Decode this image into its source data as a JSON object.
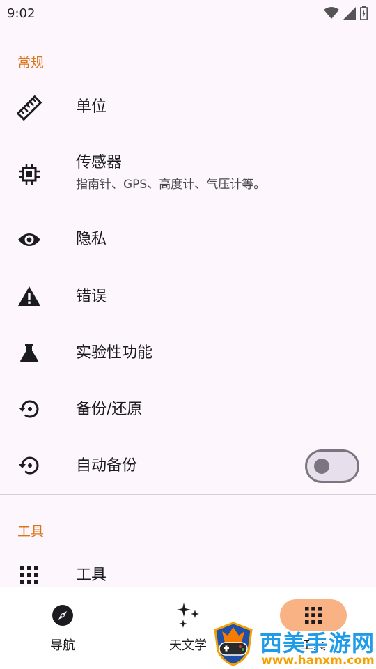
{
  "status_bar": {
    "time": "9:02"
  },
  "sections": {
    "general": {
      "title": "常规",
      "items": [
        {
          "icon": "ruler-icon",
          "title": "单位"
        },
        {
          "icon": "chip-icon",
          "title": "传感器",
          "subtitle": "指南针、GPS、高度计、气压计等。"
        },
        {
          "icon": "eye-icon",
          "title": "隐私"
        },
        {
          "icon": "warning-icon",
          "title": "错误"
        },
        {
          "icon": "flask-icon",
          "title": "实验性功能"
        },
        {
          "icon": "restore-icon",
          "title": "备份/还原"
        },
        {
          "icon": "restore-icon",
          "title": "自动备份",
          "toggle": false
        }
      ]
    },
    "tools": {
      "title": "工具",
      "items": [
        {
          "icon": "grid-icon",
          "title": "工具"
        }
      ]
    }
  },
  "bottom_nav": [
    {
      "icon": "compass-icon",
      "label": "导航"
    },
    {
      "icon": "sparkles-icon",
      "label": "天文学"
    },
    {
      "icon": "grid-icon",
      "label": "工具",
      "active": true
    }
  ],
  "watermark": {
    "title": "西美手游网",
    "url": "www.hanxm.com"
  },
  "colors": {
    "accent": "#d9751a",
    "active_nav": "#f8b284",
    "background": "#fdf7fd"
  }
}
